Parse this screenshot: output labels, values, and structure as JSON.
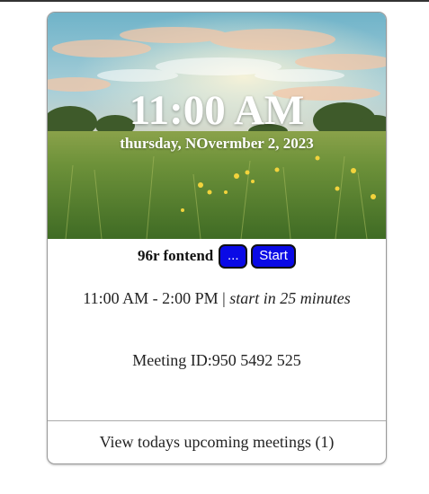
{
  "clock": {
    "time": "11:00 AM",
    "date": "thursday, NOvermber 2, 2023"
  },
  "meeting": {
    "name": "96r fontend",
    "more_label": "...",
    "start_label": "Start",
    "time_range": "11:00 AM - 2:00 PM",
    "separator": " | ",
    "starts_in": "start in 25 minutes",
    "meeting_id": "Meeting ID:950 5492 525"
  },
  "footer": {
    "upcoming_label": "View todays upcoming meetings (1)"
  },
  "colors": {
    "button": "#0a0ae6",
    "sky": "#8cc3d8",
    "grass": "#4e7a2c"
  },
  "icons": {
    "background_image": "meadow-sunrise-image"
  }
}
